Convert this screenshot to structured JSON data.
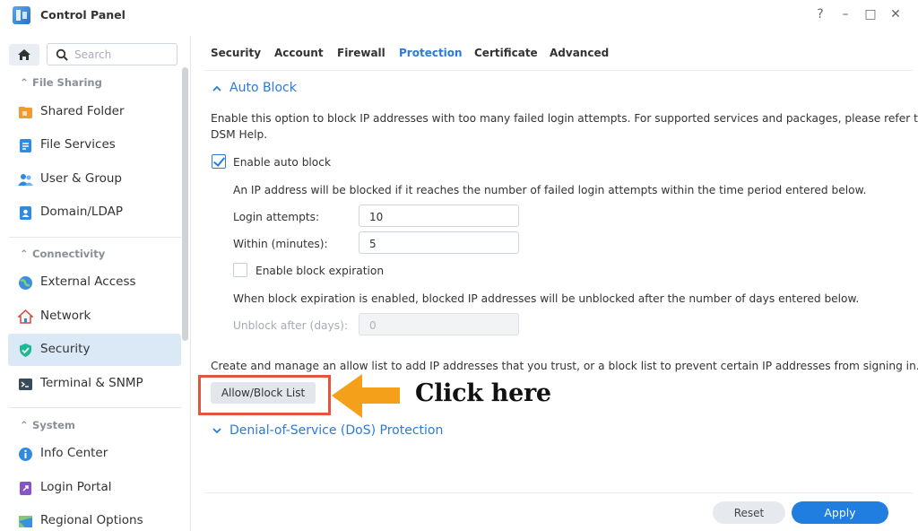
{
  "window": {
    "title": "Control Panel",
    "controls": [
      "?",
      "–",
      "□",
      "✕"
    ]
  },
  "sidebar": {
    "search_placeholder": "Search",
    "sections": [
      {
        "label": "File Sharing",
        "items": [
          {
            "label": "Shared Folder",
            "icon": "folder-icon"
          },
          {
            "label": "File Services",
            "icon": "file-services-icon"
          },
          {
            "label": "User & Group",
            "icon": "users-icon"
          },
          {
            "label": "Domain/LDAP",
            "icon": "domain-icon"
          }
        ]
      },
      {
        "label": "Connectivity",
        "items": [
          {
            "label": "External Access",
            "icon": "globe-icon"
          },
          {
            "label": "Network",
            "icon": "house-icon"
          },
          {
            "label": "Security",
            "icon": "shield-icon",
            "active": true
          },
          {
            "label": "Terminal & SNMP",
            "icon": "terminal-icon"
          }
        ]
      },
      {
        "label": "System",
        "items": [
          {
            "label": "Info Center",
            "icon": "info-icon"
          },
          {
            "label": "Login Portal",
            "icon": "portal-icon"
          },
          {
            "label": "Regional Options",
            "icon": "map-icon"
          }
        ]
      }
    ]
  },
  "tabs": [
    "Security",
    "Account",
    "Firewall",
    "Protection",
    "Certificate",
    "Advanced"
  ],
  "active_tab": "Protection",
  "auto_block": {
    "title": "Auto Block",
    "description_line1": "Enable this option to block IP addresses with too many failed login attempts. For supported services and packages, please refer to",
    "description_line2": "DSM Help.",
    "enable_label": "Enable auto block",
    "enable_checked": true,
    "info": "An IP address will be blocked if it reaches the number of failed login attempts within the time period entered below.",
    "login_attempts_label": "Login attempts:",
    "login_attempts_value": "10",
    "within_label": "Within (minutes):",
    "within_value": "5",
    "expiration_label": "Enable block expiration",
    "expiration_checked": false,
    "expiration_info": "When block expiration is enabled, blocked IP addresses will be unblocked after the number of days entered below.",
    "unblock_label": "Unblock after (days):",
    "unblock_value": "0",
    "list_info": "Create and manage an allow list to add IP addresses that you trust, or a block list to prevent certain IP addresses from signing in.",
    "list_button": "Allow/Block List"
  },
  "annotation": {
    "text": "Click here",
    "arrow_color": "#f5a01a",
    "box_color": "#e4553f"
  },
  "dos": {
    "title": "Denial-of-Service (DoS) Protection"
  },
  "footer": {
    "reset": "Reset",
    "apply": "Apply"
  },
  "colors": {
    "accent": "#2b7bd6",
    "apply": "#1f7ee0",
    "active_item_bg": "#dbe9f7"
  }
}
